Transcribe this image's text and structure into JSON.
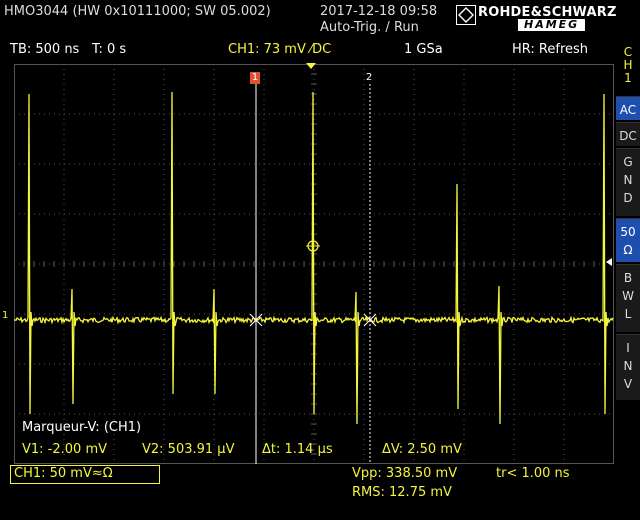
{
  "header": {
    "device": "HMO3044 (HW 0x10111000; SW 05.002)",
    "datetime": "2017-12-18 09:58",
    "trigger_mode": "Auto-Trig. / Run",
    "brand_top": "ROHDE&SCHWARZ",
    "brand_bottom": "HAMEG"
  },
  "status": {
    "timebase": "TB: 500 ns",
    "t_offset": "T: 0 s",
    "channel": "CH1: 73 mV ⁄DC",
    "sample_rate": "1 GSa",
    "mode": "HR: Refresh"
  },
  "sidebar": {
    "channel_label": "C H 1",
    "buttons": [
      "AC",
      "DC",
      "G N D",
      "50 Ω",
      "B W L",
      "I N V"
    ],
    "active": [
      "AC",
      "50 Ω"
    ]
  },
  "markers": {
    "m1": "1",
    "m2": "2",
    "ch_marker": "1"
  },
  "readout": {
    "title": "Marqueur-V: (CH1)",
    "v1": "V1: -2.00 mV",
    "v2": "V2: 503.91 µV",
    "dt": "Δt: 1.14 µs",
    "dv": "ΔV: 2.50 mV"
  },
  "bottom": {
    "ch1_scale": "CH1: 50 mV≈Ω",
    "vpp": "Vpp: 338.50 mV",
    "rms": "RMS: 12.75 mV",
    "rise": "tr< 1.00 ns"
  },
  "colors": {
    "trace": "#f5f53c",
    "grid": "#555555",
    "active_button": "#1f4fae",
    "marker1": "#e0522d"
  }
}
